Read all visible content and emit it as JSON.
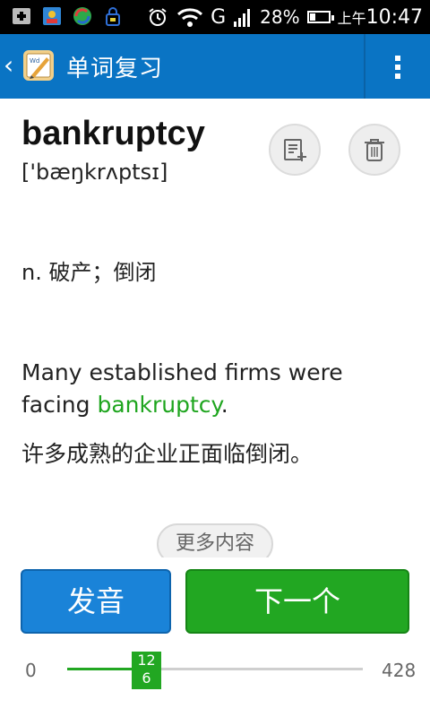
{
  "status_bar": {
    "signal_label": "G",
    "battery": "28%",
    "time_prefix": "上午",
    "time": "10:47"
  },
  "action_bar": {
    "title": "单词复习"
  },
  "word": {
    "headword": "bankruptcy",
    "phonetic": "['bæŋkrʌptsɪ]",
    "definition": "n. 破产；倒闭",
    "example_before": "Many established firms were facing ",
    "example_highlight": "bankruptcy",
    "example_after": ".",
    "translation": "许多成熟的企业正面临倒闭。"
  },
  "more_button": "更多内容",
  "buttons": {
    "pronounce": "发音",
    "next": "下一个"
  },
  "progress": {
    "min": "0",
    "max": "428",
    "current": "126",
    "current_line1": "12",
    "current_line2": "6",
    "fraction": 0.294
  },
  "colors": {
    "action_bar": "#0a74c4",
    "highlight": "#1ea51e",
    "pronounce_button": "#1a83d8",
    "next_button": "#22a722"
  }
}
